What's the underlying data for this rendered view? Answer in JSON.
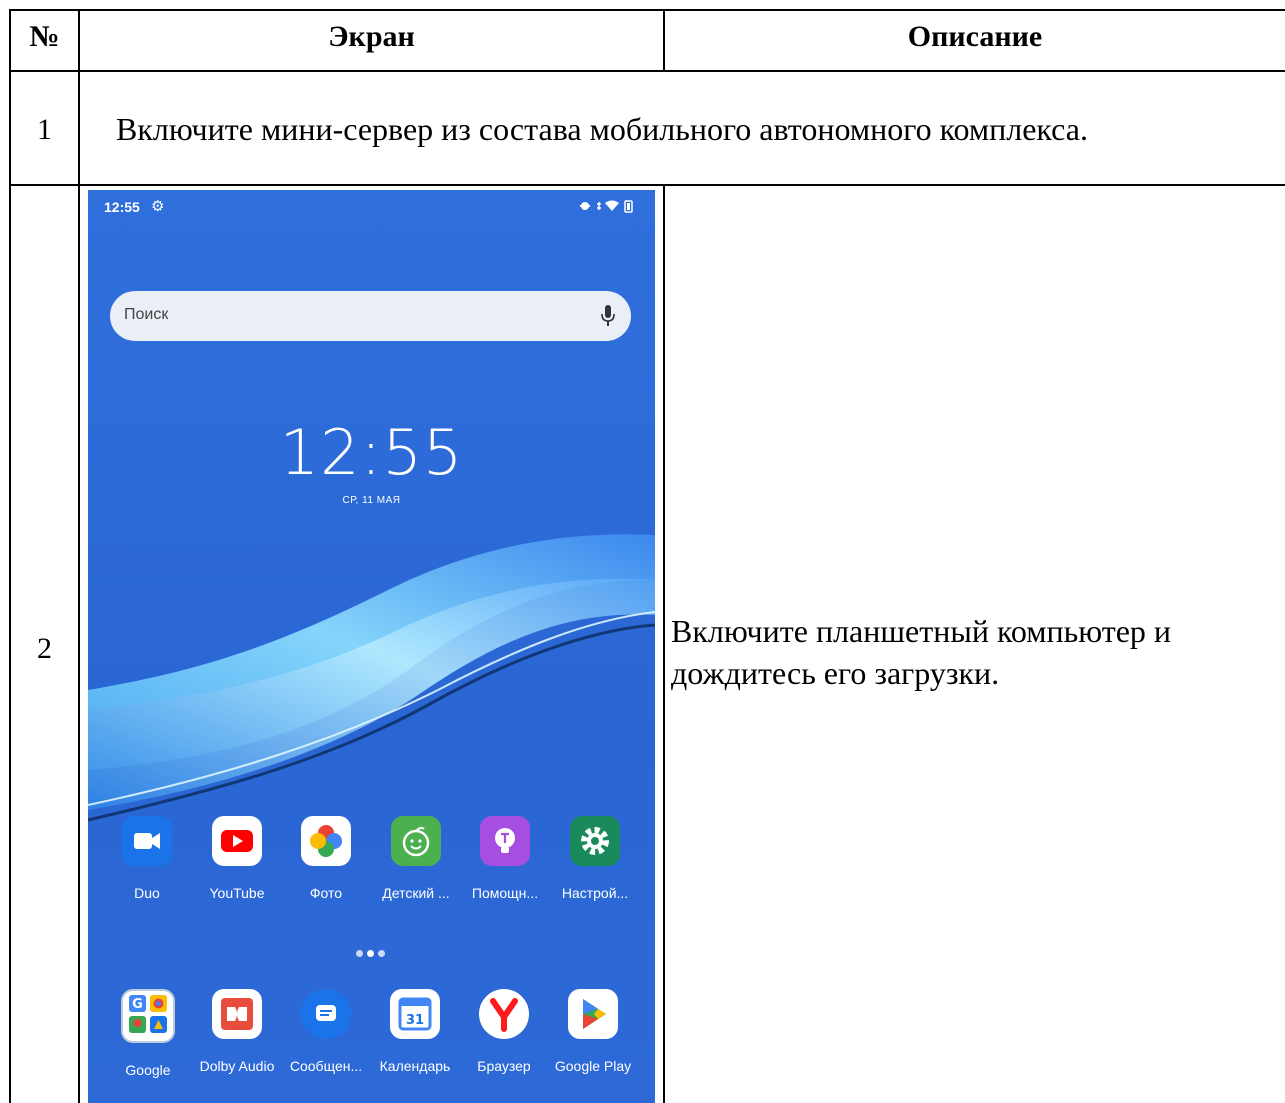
{
  "table": {
    "headers": {
      "num": "№",
      "screen": "Экран",
      "description": "Описание"
    },
    "rows": [
      {
        "num": "1",
        "text": "Включите мини-сервер из состава мобильного автономного комплекса."
      },
      {
        "num": "2",
        "description_lines": [
          "Включите планшетный компьютер и",
          "дождитесь его загрузки."
        ]
      }
    ]
  },
  "tablet": {
    "status_time": "12:55",
    "search_placeholder": "Поиск",
    "clock": "12:55",
    "date": "СР, 11 МАЯ",
    "apps_row1": [
      {
        "label": "Duo",
        "icon": "duo-icon",
        "color": "#1a73e8"
      },
      {
        "label": "YouTube",
        "icon": "youtube-icon",
        "color": "#ff0000"
      },
      {
        "label": "Фото",
        "icon": "photos-icon",
        "color": "#ffffff"
      },
      {
        "label": "Детский ...",
        "icon": "kids-space-icon",
        "color": "#4caf50"
      },
      {
        "label": "Помощн...",
        "icon": "tips-icon",
        "color": "#a64ee0"
      },
      {
        "label": "Настрой...",
        "icon": "settings-icon",
        "color": "#1b8a5a"
      }
    ],
    "apps_row2": [
      {
        "label": "Google",
        "icon": "google-folder-icon",
        "color": "#ffffff"
      },
      {
        "label": "Dolby Audio",
        "icon": "dolby-audio-icon",
        "color": "#e74c3c"
      },
      {
        "label": "Сообщен...",
        "icon": "messages-icon",
        "color": "#1a73e8"
      },
      {
        "label": "Календарь",
        "icon": "calendar-icon",
        "color": "#ffffff"
      },
      {
        "label": "Браузер",
        "icon": "yandex-browser-icon",
        "color": "#ffffff"
      },
      {
        "label": "Google Play",
        "icon": "google-play-icon",
        "color": "#ffffff"
      }
    ]
  }
}
